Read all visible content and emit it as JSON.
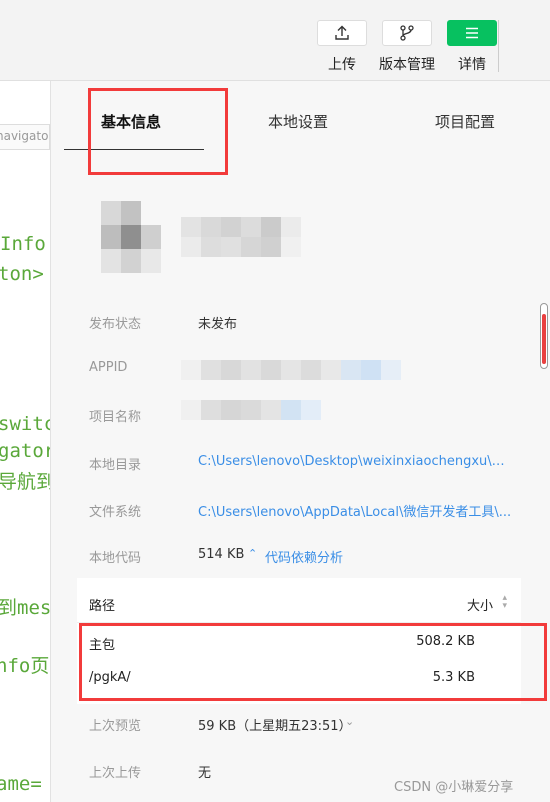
{
  "toolbar": {
    "upload_label": "上传",
    "version_label": "版本管理",
    "details_label": "详情"
  },
  "editor": {
    "tab_text": "navigato",
    "code_lines": [
      "Info",
      "ton>",
      "switc",
      "gator",
      "导航到",
      "到mes",
      "nfo页",
      "ame="
    ]
  },
  "tabs": {
    "basic": "基本信息",
    "local": "本地设置",
    "project": "项目配置"
  },
  "info": {
    "publish_status_label": "发布状态",
    "publish_status_value": "未发布",
    "appid_label": "APPID",
    "project_name_label": "项目名称",
    "local_dir_label": "本地目录",
    "local_dir_value": "C:\\Users\\lenovo\\Desktop\\weixinxiaochengxu\\mkb...",
    "file_system_label": "文件系统",
    "file_system_value": "C:\\Users\\lenovo\\AppData\\Local\\微信开发者工具\\...",
    "local_code_label": "本地代码",
    "local_code_value": "514 KB",
    "dependency_link": "代码依赖分析",
    "last_preview_label": "上次预览",
    "last_preview_value": "59 KB（上星期五23:51）",
    "last_upload_label": "上次上传",
    "last_upload_value": "无"
  },
  "size_table": {
    "header_path": "路径",
    "header_size": "大小",
    "rows": [
      {
        "path": "主包",
        "size": "508.2 KB"
      },
      {
        "path": "/pgkA/",
        "size": "5.3 KB"
      }
    ]
  },
  "watermark": "CSDN @小琳爱分享",
  "colors": {
    "accent_green": "#07c160",
    "link_blue": "#3a8ee6",
    "highlight_red": "#f23b3b",
    "code_green": "#5aa83a"
  }
}
